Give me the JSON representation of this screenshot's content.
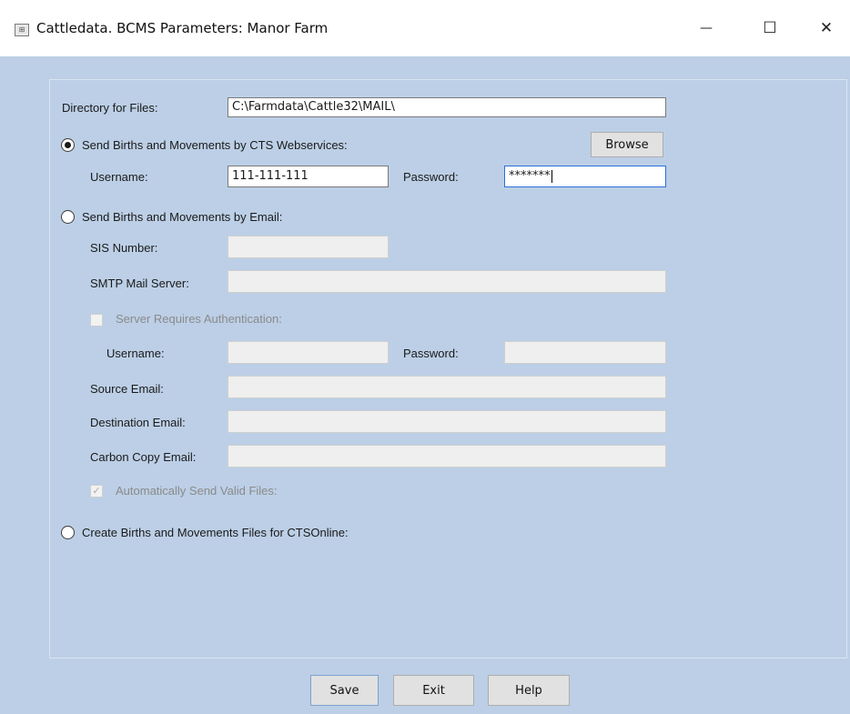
{
  "window": {
    "title": "Cattledata. BCMS Parameters: Manor Farm",
    "minimize_glyph": "—",
    "maximize_glyph": "☐",
    "close_glyph": "✕"
  },
  "directory": {
    "label": "Directory for Files:",
    "value": "C:\\Farmdata\\Cattle32\\MAIL\\"
  },
  "webservices": {
    "radio_label": "Send Births and Movements by CTS Webservices:",
    "selected": true,
    "browse_label": "Browse",
    "username_label": "Username:",
    "username_value": "111-111-111",
    "password_label": "Password:",
    "password_value": "*******"
  },
  "email": {
    "radio_label": "Send Births and Movements by Email:",
    "selected": false,
    "sis_label": "SIS Number:",
    "smtp_label": "SMTP Mail Server:",
    "auth_label": "Server Requires Authentication:",
    "auth_username_label": "Username:",
    "auth_password_label": "Password:",
    "source_label": "Source Email:",
    "destination_label": "Destination Email:",
    "cc_label": "Carbon Copy Email:",
    "auto_send_label": "Automatically Send Valid Files:",
    "auto_send_checked": true
  },
  "ctsonline": {
    "radio_label": "Create Births and Movements Files for CTSOnline:",
    "selected": false
  },
  "footer": {
    "save_label": "Save",
    "exit_label": "Exit",
    "help_label": "Help"
  },
  "icons": {
    "app": "app-icon",
    "check": "checkmark-icon"
  },
  "colors": {
    "background": "#bccfe6",
    "focus_border": "#2b6fd6"
  }
}
